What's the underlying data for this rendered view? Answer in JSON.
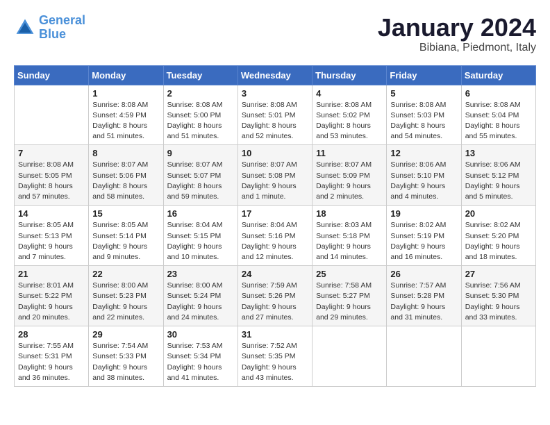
{
  "logo": {
    "line1": "General",
    "line2": "Blue"
  },
  "title": "January 2024",
  "subtitle": "Bibiana, Piedmont, Italy",
  "weekdays": [
    "Sunday",
    "Monday",
    "Tuesday",
    "Wednesday",
    "Thursday",
    "Friday",
    "Saturday"
  ],
  "weeks": [
    [
      {
        "day": "",
        "info": ""
      },
      {
        "day": "1",
        "info": "Sunrise: 8:08 AM\nSunset: 4:59 PM\nDaylight: 8 hours\nand 51 minutes."
      },
      {
        "day": "2",
        "info": "Sunrise: 8:08 AM\nSunset: 5:00 PM\nDaylight: 8 hours\nand 51 minutes."
      },
      {
        "day": "3",
        "info": "Sunrise: 8:08 AM\nSunset: 5:01 PM\nDaylight: 8 hours\nand 52 minutes."
      },
      {
        "day": "4",
        "info": "Sunrise: 8:08 AM\nSunset: 5:02 PM\nDaylight: 8 hours\nand 53 minutes."
      },
      {
        "day": "5",
        "info": "Sunrise: 8:08 AM\nSunset: 5:03 PM\nDaylight: 8 hours\nand 54 minutes."
      },
      {
        "day": "6",
        "info": "Sunrise: 8:08 AM\nSunset: 5:04 PM\nDaylight: 8 hours\nand 55 minutes."
      }
    ],
    [
      {
        "day": "7",
        "info": "Sunrise: 8:08 AM\nSunset: 5:05 PM\nDaylight: 8 hours\nand 57 minutes."
      },
      {
        "day": "8",
        "info": "Sunrise: 8:07 AM\nSunset: 5:06 PM\nDaylight: 8 hours\nand 58 minutes."
      },
      {
        "day": "9",
        "info": "Sunrise: 8:07 AM\nSunset: 5:07 PM\nDaylight: 8 hours\nand 59 minutes."
      },
      {
        "day": "10",
        "info": "Sunrise: 8:07 AM\nSunset: 5:08 PM\nDaylight: 9 hours\nand 1 minute."
      },
      {
        "day": "11",
        "info": "Sunrise: 8:07 AM\nSunset: 5:09 PM\nDaylight: 9 hours\nand 2 minutes."
      },
      {
        "day": "12",
        "info": "Sunrise: 8:06 AM\nSunset: 5:10 PM\nDaylight: 9 hours\nand 4 minutes."
      },
      {
        "day": "13",
        "info": "Sunrise: 8:06 AM\nSunset: 5:12 PM\nDaylight: 9 hours\nand 5 minutes."
      }
    ],
    [
      {
        "day": "14",
        "info": "Sunrise: 8:05 AM\nSunset: 5:13 PM\nDaylight: 9 hours\nand 7 minutes."
      },
      {
        "day": "15",
        "info": "Sunrise: 8:05 AM\nSunset: 5:14 PM\nDaylight: 9 hours\nand 9 minutes."
      },
      {
        "day": "16",
        "info": "Sunrise: 8:04 AM\nSunset: 5:15 PM\nDaylight: 9 hours\nand 10 minutes."
      },
      {
        "day": "17",
        "info": "Sunrise: 8:04 AM\nSunset: 5:16 PM\nDaylight: 9 hours\nand 12 minutes."
      },
      {
        "day": "18",
        "info": "Sunrise: 8:03 AM\nSunset: 5:18 PM\nDaylight: 9 hours\nand 14 minutes."
      },
      {
        "day": "19",
        "info": "Sunrise: 8:02 AM\nSunset: 5:19 PM\nDaylight: 9 hours\nand 16 minutes."
      },
      {
        "day": "20",
        "info": "Sunrise: 8:02 AM\nSunset: 5:20 PM\nDaylight: 9 hours\nand 18 minutes."
      }
    ],
    [
      {
        "day": "21",
        "info": "Sunrise: 8:01 AM\nSunset: 5:22 PM\nDaylight: 9 hours\nand 20 minutes."
      },
      {
        "day": "22",
        "info": "Sunrise: 8:00 AM\nSunset: 5:23 PM\nDaylight: 9 hours\nand 22 minutes."
      },
      {
        "day": "23",
        "info": "Sunrise: 8:00 AM\nSunset: 5:24 PM\nDaylight: 9 hours\nand 24 minutes."
      },
      {
        "day": "24",
        "info": "Sunrise: 7:59 AM\nSunset: 5:26 PM\nDaylight: 9 hours\nand 27 minutes."
      },
      {
        "day": "25",
        "info": "Sunrise: 7:58 AM\nSunset: 5:27 PM\nDaylight: 9 hours\nand 29 minutes."
      },
      {
        "day": "26",
        "info": "Sunrise: 7:57 AM\nSunset: 5:28 PM\nDaylight: 9 hours\nand 31 minutes."
      },
      {
        "day": "27",
        "info": "Sunrise: 7:56 AM\nSunset: 5:30 PM\nDaylight: 9 hours\nand 33 minutes."
      }
    ],
    [
      {
        "day": "28",
        "info": "Sunrise: 7:55 AM\nSunset: 5:31 PM\nDaylight: 9 hours\nand 36 minutes."
      },
      {
        "day": "29",
        "info": "Sunrise: 7:54 AM\nSunset: 5:33 PM\nDaylight: 9 hours\nand 38 minutes."
      },
      {
        "day": "30",
        "info": "Sunrise: 7:53 AM\nSunset: 5:34 PM\nDaylight: 9 hours\nand 41 minutes."
      },
      {
        "day": "31",
        "info": "Sunrise: 7:52 AM\nSunset: 5:35 PM\nDaylight: 9 hours\nand 43 minutes."
      },
      {
        "day": "",
        "info": ""
      },
      {
        "day": "",
        "info": ""
      },
      {
        "day": "",
        "info": ""
      }
    ]
  ]
}
